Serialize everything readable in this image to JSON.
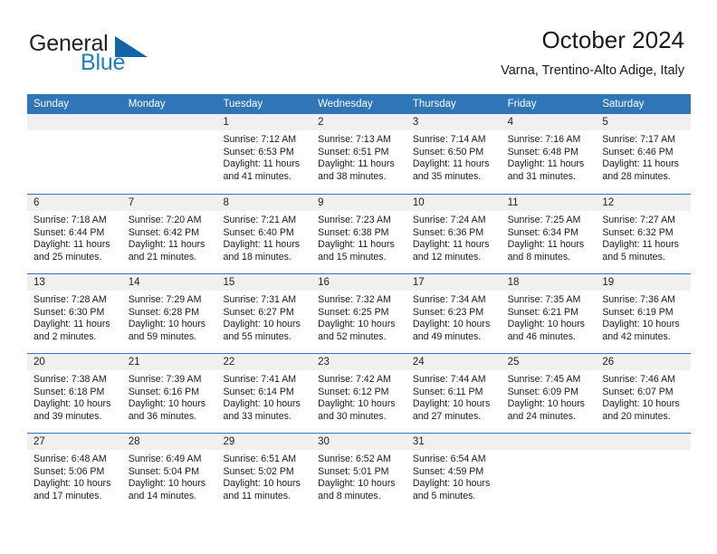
{
  "brand": {
    "word1": "General",
    "word2": "Blue",
    "logo_icon": "blue-triangle-icon",
    "accent_color": "#1266a8"
  },
  "header": {
    "title": "October 2024",
    "subtitle": "Varna, Trentino-Alto Adige, Italy"
  },
  "calendar": {
    "header_bg": "#2e76b8",
    "daynum_bg": "#f0f0f0",
    "weekdays": [
      "Sunday",
      "Monday",
      "Tuesday",
      "Wednesday",
      "Thursday",
      "Friday",
      "Saturday"
    ],
    "weeks": [
      [
        {
          "day": "",
          "lines": []
        },
        {
          "day": "",
          "lines": []
        },
        {
          "day": "1",
          "lines": [
            "Sunrise: 7:12 AM",
            "Sunset: 6:53 PM",
            "Daylight: 11 hours",
            "and 41 minutes."
          ]
        },
        {
          "day": "2",
          "lines": [
            "Sunrise: 7:13 AM",
            "Sunset: 6:51 PM",
            "Daylight: 11 hours",
            "and 38 minutes."
          ]
        },
        {
          "day": "3",
          "lines": [
            "Sunrise: 7:14 AM",
            "Sunset: 6:50 PM",
            "Daylight: 11 hours",
            "and 35 minutes."
          ]
        },
        {
          "day": "4",
          "lines": [
            "Sunrise: 7:16 AM",
            "Sunset: 6:48 PM",
            "Daylight: 11 hours",
            "and 31 minutes."
          ]
        },
        {
          "day": "5",
          "lines": [
            "Sunrise: 7:17 AM",
            "Sunset: 6:46 PM",
            "Daylight: 11 hours",
            "and 28 minutes."
          ]
        }
      ],
      [
        {
          "day": "6",
          "lines": [
            "Sunrise: 7:18 AM",
            "Sunset: 6:44 PM",
            "Daylight: 11 hours",
            "and 25 minutes."
          ]
        },
        {
          "day": "7",
          "lines": [
            "Sunrise: 7:20 AM",
            "Sunset: 6:42 PM",
            "Daylight: 11 hours",
            "and 21 minutes."
          ]
        },
        {
          "day": "8",
          "lines": [
            "Sunrise: 7:21 AM",
            "Sunset: 6:40 PM",
            "Daylight: 11 hours",
            "and 18 minutes."
          ]
        },
        {
          "day": "9",
          "lines": [
            "Sunrise: 7:23 AM",
            "Sunset: 6:38 PM",
            "Daylight: 11 hours",
            "and 15 minutes."
          ]
        },
        {
          "day": "10",
          "lines": [
            "Sunrise: 7:24 AM",
            "Sunset: 6:36 PM",
            "Daylight: 11 hours",
            "and 12 minutes."
          ]
        },
        {
          "day": "11",
          "lines": [
            "Sunrise: 7:25 AM",
            "Sunset: 6:34 PM",
            "Daylight: 11 hours",
            "and 8 minutes."
          ]
        },
        {
          "day": "12",
          "lines": [
            "Sunrise: 7:27 AM",
            "Sunset: 6:32 PM",
            "Daylight: 11 hours",
            "and 5 minutes."
          ]
        }
      ],
      [
        {
          "day": "13",
          "lines": [
            "Sunrise: 7:28 AM",
            "Sunset: 6:30 PM",
            "Daylight: 11 hours",
            "and 2 minutes."
          ]
        },
        {
          "day": "14",
          "lines": [
            "Sunrise: 7:29 AM",
            "Sunset: 6:28 PM",
            "Daylight: 10 hours",
            "and 59 minutes."
          ]
        },
        {
          "day": "15",
          "lines": [
            "Sunrise: 7:31 AM",
            "Sunset: 6:27 PM",
            "Daylight: 10 hours",
            "and 55 minutes."
          ]
        },
        {
          "day": "16",
          "lines": [
            "Sunrise: 7:32 AM",
            "Sunset: 6:25 PM",
            "Daylight: 10 hours",
            "and 52 minutes."
          ]
        },
        {
          "day": "17",
          "lines": [
            "Sunrise: 7:34 AM",
            "Sunset: 6:23 PM",
            "Daylight: 10 hours",
            "and 49 minutes."
          ]
        },
        {
          "day": "18",
          "lines": [
            "Sunrise: 7:35 AM",
            "Sunset: 6:21 PM",
            "Daylight: 10 hours",
            "and 46 minutes."
          ]
        },
        {
          "day": "19",
          "lines": [
            "Sunrise: 7:36 AM",
            "Sunset: 6:19 PM",
            "Daylight: 10 hours",
            "and 42 minutes."
          ]
        }
      ],
      [
        {
          "day": "20",
          "lines": [
            "Sunrise: 7:38 AM",
            "Sunset: 6:18 PM",
            "Daylight: 10 hours",
            "and 39 minutes."
          ]
        },
        {
          "day": "21",
          "lines": [
            "Sunrise: 7:39 AM",
            "Sunset: 6:16 PM",
            "Daylight: 10 hours",
            "and 36 minutes."
          ]
        },
        {
          "day": "22",
          "lines": [
            "Sunrise: 7:41 AM",
            "Sunset: 6:14 PM",
            "Daylight: 10 hours",
            "and 33 minutes."
          ]
        },
        {
          "day": "23",
          "lines": [
            "Sunrise: 7:42 AM",
            "Sunset: 6:12 PM",
            "Daylight: 10 hours",
            "and 30 minutes."
          ]
        },
        {
          "day": "24",
          "lines": [
            "Sunrise: 7:44 AM",
            "Sunset: 6:11 PM",
            "Daylight: 10 hours",
            "and 27 minutes."
          ]
        },
        {
          "day": "25",
          "lines": [
            "Sunrise: 7:45 AM",
            "Sunset: 6:09 PM",
            "Daylight: 10 hours",
            "and 24 minutes."
          ]
        },
        {
          "day": "26",
          "lines": [
            "Sunrise: 7:46 AM",
            "Sunset: 6:07 PM",
            "Daylight: 10 hours",
            "and 20 minutes."
          ]
        }
      ],
      [
        {
          "day": "27",
          "lines": [
            "Sunrise: 6:48 AM",
            "Sunset: 5:06 PM",
            "Daylight: 10 hours",
            "and 17 minutes."
          ]
        },
        {
          "day": "28",
          "lines": [
            "Sunrise: 6:49 AM",
            "Sunset: 5:04 PM",
            "Daylight: 10 hours",
            "and 14 minutes."
          ]
        },
        {
          "day": "29",
          "lines": [
            "Sunrise: 6:51 AM",
            "Sunset: 5:02 PM",
            "Daylight: 10 hours",
            "and 11 minutes."
          ]
        },
        {
          "day": "30",
          "lines": [
            "Sunrise: 6:52 AM",
            "Sunset: 5:01 PM",
            "Daylight: 10 hours",
            "and 8 minutes."
          ]
        },
        {
          "day": "31",
          "lines": [
            "Sunrise: 6:54 AM",
            "Sunset: 4:59 PM",
            "Daylight: 10 hours",
            "and 5 minutes."
          ]
        },
        {
          "day": "",
          "lines": []
        },
        {
          "day": "",
          "lines": []
        }
      ]
    ]
  }
}
